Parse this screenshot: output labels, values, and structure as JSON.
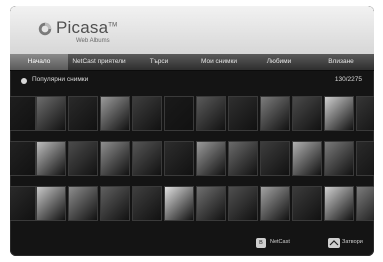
{
  "app": {
    "brand": "Picasa",
    "brand_sup": "TM",
    "sub": "Web Albums"
  },
  "tabs": [
    {
      "label": "Начало"
    },
    {
      "label": "NetCast приятели"
    },
    {
      "label": "Търси"
    },
    {
      "label": "Мои снимки"
    },
    {
      "label": "Любими"
    },
    {
      "label": "Влизане"
    }
  ],
  "section": {
    "title": "Популярни снимки",
    "count": "130/2275"
  },
  "footer": {
    "key_b": "B",
    "netcast": "NetCast",
    "close": "Затвори"
  },
  "thumbnail_colors": [
    [
      "#1f1f1f",
      "#6d6d6d",
      "#2a2a2a",
      "#9b9b9b",
      "#3e3e3e",
      "#1a1a1a",
      "#5a5a5a",
      "#2f2f2f",
      "#7c7c7c",
      "#4a4a4a",
      "#cfcfcf",
      "#353535"
    ],
    [
      "#232323",
      "#bdbdbd",
      "#4b4b4b",
      "#8e8e8e",
      "#555555",
      "#2d2d2d",
      "#9a9a9a",
      "#6a6a6a",
      "#3d3d3d",
      "#b0b0b0",
      "#7a7a7a",
      "#2a2a2a"
    ],
    [
      "#2b2b2b",
      "#c8c8c8",
      "#8d8d8d",
      "#5f5f5f",
      "#3f3f3f",
      "#e0e0e0",
      "#6f6f6f",
      "#4f4f4f",
      "#a3a3a3",
      "#3b3b3b",
      "#d0d0d0",
      "#7b7b7b"
    ]
  ]
}
